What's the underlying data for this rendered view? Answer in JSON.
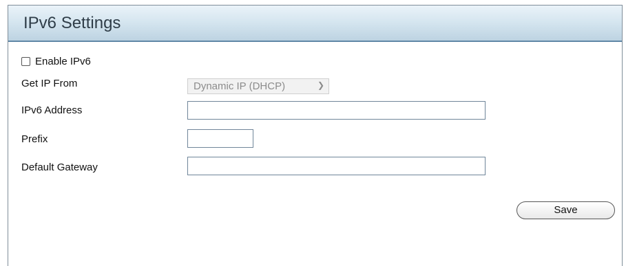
{
  "header": {
    "title": "IPv6 Settings"
  },
  "enable": {
    "label": "Enable IPv6",
    "checked": false
  },
  "get_ip_from": {
    "label": "Get IP From",
    "selected": "Dynamic IP (DHCP)"
  },
  "ipv6_address": {
    "label": "IPv6 Address",
    "value": ""
  },
  "prefix": {
    "label": "Prefix",
    "value": ""
  },
  "default_gateway": {
    "label": "Default Gateway",
    "value": ""
  },
  "actions": {
    "save_label": "Save"
  },
  "colors": {
    "header_border": "#5f87a6",
    "header_bg": "#d6e6f0",
    "input_border": "#6f8599"
  },
  "icons": {
    "select_arrow": "chevron-down-icon"
  }
}
